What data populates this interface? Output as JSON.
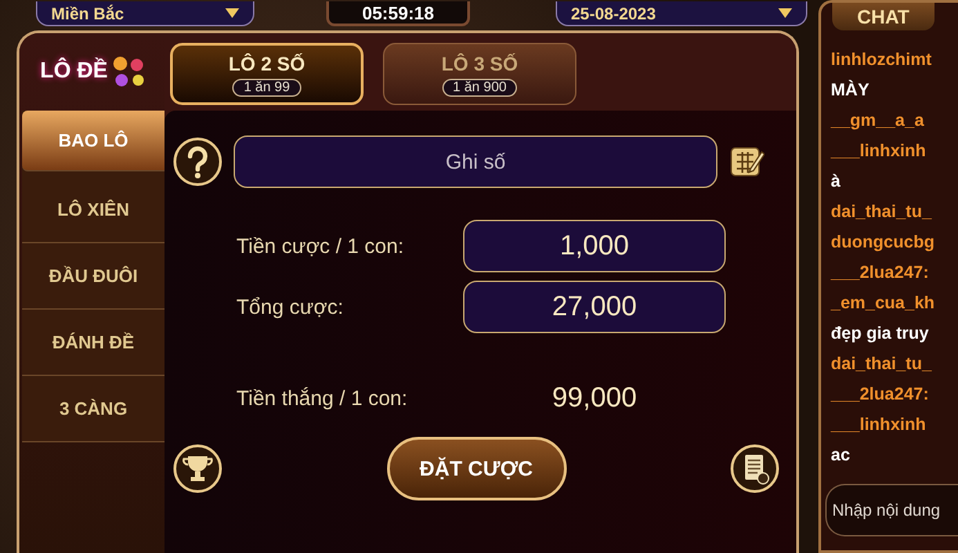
{
  "header": {
    "region": {
      "label": "Miền Bắc"
    },
    "timer": "05:59:18",
    "date": {
      "label": "25-08-2023"
    }
  },
  "logo": {
    "text": "LÔ ĐỀ"
  },
  "tabs": [
    {
      "label": "LÔ 2 SỐ",
      "odds": "1 ăn 99",
      "selected": true
    },
    {
      "label": "LÔ 3 SỐ",
      "odds": "1 ăn 900",
      "selected": false
    }
  ],
  "menu": [
    {
      "label": "BAO LÔ",
      "selected": true
    },
    {
      "label": "LÔ XIÊN",
      "selected": false
    },
    {
      "label": "ĐẦU ĐUÔI",
      "selected": false
    },
    {
      "label": "ĐÁNH ĐỀ",
      "selected": false
    },
    {
      "label": "3 CÀNG",
      "selected": false
    }
  ],
  "number_field": {
    "placeholder": "Ghi số"
  },
  "fields": [
    {
      "label": "Tiền cược / 1 con:",
      "value": "1,000",
      "kind": "input"
    },
    {
      "label": "Tổng cược:",
      "value": "27,000",
      "kind": "input"
    },
    {
      "label": "Tiền thắng / 1 con:",
      "value": "99,000",
      "kind": "text"
    }
  ],
  "bet_button": {
    "label": "ĐẶT CƯỢC"
  },
  "chat": {
    "title": "CHAT",
    "messages": [
      {
        "text": "linhlozchimt",
        "kind": "name"
      },
      {
        "text": "MÀY",
        "kind": "text"
      },
      {
        "text": "__gm__a_a",
        "kind": "name"
      },
      {
        "text": "___linhxinh",
        "kind": "name"
      },
      {
        "text": "à",
        "kind": "text"
      },
      {
        "text": "dai_thai_tu_",
        "kind": "name"
      },
      {
        "text": "duongcucbg",
        "kind": "name"
      },
      {
        "text": "___2lua247:",
        "kind": "name"
      },
      {
        "text": "_em_cua_kh",
        "kind": "name"
      },
      {
        "text": "đẹp gia truy",
        "kind": "text"
      },
      {
        "text": "dai_thai_tu_",
        "kind": "name"
      },
      {
        "text": "___2lua247:",
        "kind": "name"
      },
      {
        "text": "___linhxinh",
        "kind": "name"
      },
      {
        "text": "ac",
        "kind": "text"
      }
    ],
    "input": {
      "placeholder": "Nhập nội dung"
    }
  }
}
